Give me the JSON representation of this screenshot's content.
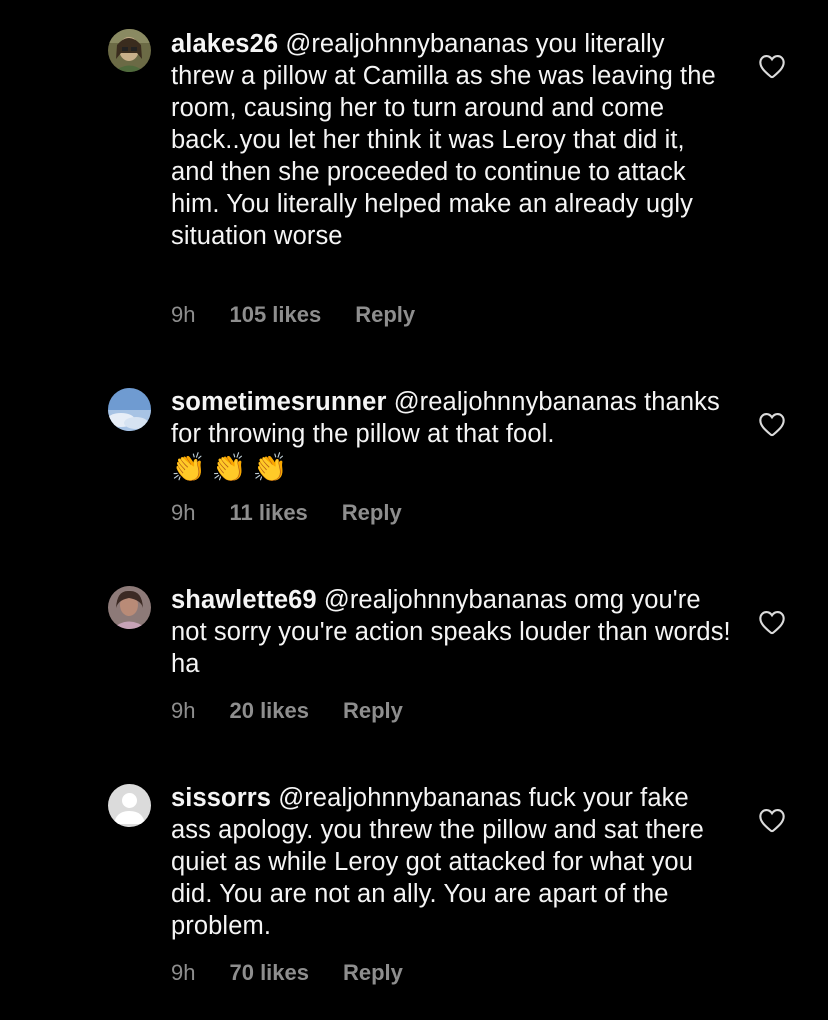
{
  "comments": [
    {
      "username": "alakes26",
      "mention": "@realjohnnybananas",
      "text": "you literally threw a pillow at Camilla as she was leaving the room, causing her to turn around and come back..you let her think it was Leroy that did it, and then she proceeded to continue to attack him. You literally helped make an already ugly situation worse",
      "time": "9h",
      "likes": "105 likes",
      "reply": "Reply",
      "avatar": "user-photo-avatar"
    },
    {
      "username": "sometimesrunner",
      "mention": "@realjohnnybananas",
      "text": "thanks for throwing the pillow at that fool.",
      "emoji": "👏👏👏",
      "time": "9h",
      "likes": "11 likes",
      "reply": "Reply",
      "avatar": "sky-photo-avatar"
    },
    {
      "username": "shawlette69",
      "mention": "@realjohnnybananas",
      "text": "omg you're not sorry you're action speaks louder than words! ha",
      "time": "9h",
      "likes": "20 likes",
      "reply": "Reply",
      "avatar": "user-photo-avatar"
    },
    {
      "username": "sissorrs",
      "mention": "@realjohnnybananas",
      "text": "fuck your fake ass apology. you threw the pillow and sat there quiet as while Leroy got attacked for what you did. You are not an ally. You are apart of the problem.",
      "time": "9h",
      "likes": "70 likes",
      "reply": "Reply",
      "avatar": "default-user-avatar"
    }
  ],
  "colors": {
    "background": "#000000",
    "text": "#f5f5f5",
    "meta": "#8e8e8e",
    "heart": "#dbdbdb"
  },
  "icons": {
    "like": "heart-outline-icon"
  }
}
